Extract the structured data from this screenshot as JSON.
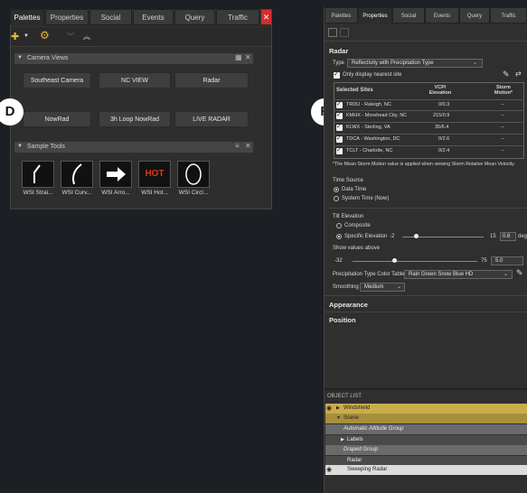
{
  "left_panel": {
    "tabs": [
      "Palettes",
      "Properties",
      "Social",
      "Events",
      "Query",
      "Traffic"
    ],
    "camera_views": {
      "title": "Camera Views",
      "buttons": [
        "Southeast Camera",
        "NC VIEW",
        "Radar",
        "NowRad",
        "3h Loop NowRad",
        "LIVE RADAR"
      ]
    },
    "sample_tools": {
      "title": "Sample Tools",
      "items": [
        "WSI Strai...",
        "WSI Curv...",
        "WSI Arro...",
        "WSI Hot...",
        "WSI Circl..."
      ],
      "hot_label": "HOT"
    }
  },
  "markers": {
    "d": "D",
    "f": "F"
  },
  "right_panel": {
    "tabs": [
      "Palettes",
      "Properties",
      "Social",
      "Events",
      "Query",
      "Traffic"
    ],
    "radar_title": "Radar",
    "type_label": "Type",
    "type_value": "Reflectivity with Precipitation Type",
    "only_nearest": "Only display nearest site",
    "table": {
      "headers": [
        "Selected Sites",
        "VCP/ Elevation",
        "Storm Motion*"
      ],
      "rows": [
        {
          "site": "TRDU - Raleigh, NC",
          "elev": "0/0.3",
          "motion": "--"
        },
        {
          "site": "KMHX - Morehead City, NC",
          "elev": "215/0.9",
          "motion": "--"
        },
        {
          "site": "KLWX - Sterling, VA",
          "elev": "35/6.4",
          "motion": "--"
        },
        {
          "site": "TDCA - Washington, DC",
          "elev": "0/2.6",
          "motion": "--"
        },
        {
          "site": "TCLT - Charlotte, NC",
          "elev": "0/2.4",
          "motion": "--"
        }
      ]
    },
    "footnote": "*The Mean Storm Motion value is applied when viewing Storm Relative Mean Velocity.",
    "time_source": {
      "label": "Time Source",
      "options": [
        "Data Time",
        "System Time (Now)"
      ]
    },
    "tilt": {
      "label": "Tilt Elevation",
      "options": [
        "Composite",
        "Specific Elevation"
      ],
      "min": "-2",
      "max": "15",
      "value": "0.6",
      "unit": "deg"
    },
    "show_values": {
      "label": "Show values above",
      "min": "-32",
      "max": "75",
      "value": "5.0"
    },
    "color_table": {
      "label": "Precipitation Type Color Table",
      "value": "Rain Green Snow Blue HD"
    },
    "smoothing": {
      "label": "Smoothing",
      "value": "Medium"
    },
    "appearance": "Appearance",
    "position": "Position",
    "object_list": {
      "title": "OBJECT LIST",
      "rows": [
        "Windshield",
        "Scene",
        "Automatic Altitude Group",
        "Labels",
        "Draped Group",
        "Radar",
        "Sweeping Radar"
      ]
    }
  }
}
